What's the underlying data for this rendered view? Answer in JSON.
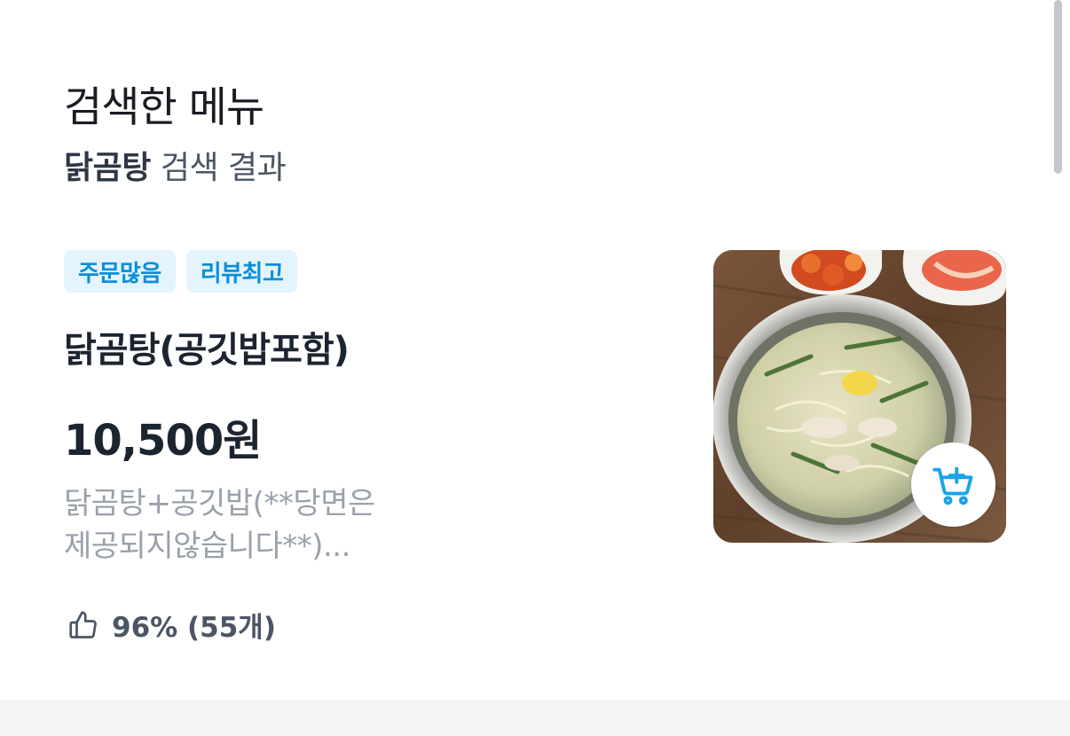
{
  "header": {
    "title": "검색한 메뉴",
    "search_keyword": "닭곰탕",
    "search_suffix": " 검색 결과"
  },
  "menu_item": {
    "tags": [
      "주문많음",
      "리뷰최고"
    ],
    "name": "닭곰탕(공깃밥포함)",
    "price": "10,500원",
    "description_line1": "닭곰탕+공깃밥(**당면은",
    "description_line2": "제공되지않습니다**)...",
    "rating_text": "96% (55개)",
    "image_icon": "food-photo",
    "cart_icon": "cart-add-icon",
    "rating_icon": "thumbs-up-icon"
  },
  "colors": {
    "tag_bg": "#e3f4fd",
    "tag_text": "#0a8fd8",
    "accent": "#1aa3e8",
    "muted_text": "#9aa1ab"
  }
}
